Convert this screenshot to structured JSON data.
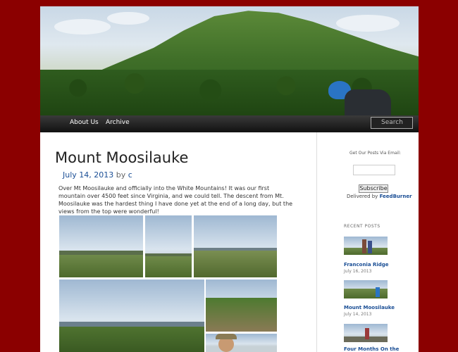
{
  "nav": {
    "items": [
      "About Us",
      "Archive"
    ],
    "search_placeholder": "Search"
  },
  "post": {
    "title": "Mount Moosilauke",
    "date": "July 14, 2013",
    "by": "by",
    "author": "c",
    "body": "Over Mt Moosilauke and officially into the White Mountains! It was our first mountain over 4500 feet since Virginia, and we could tell. The descent from Mt. Moosilauke was the hardest thing I have done yet at the end of a long day, but the views from the top were wonderful!"
  },
  "sidebar": {
    "email_label": "Get Our Posts Via Email:",
    "subscribe_label": "Subscribe",
    "delivered_by": "Delivered by",
    "feedburner": "FeedBurner",
    "recent_heading": "RECENT POSTS",
    "recent_posts": [
      {
        "title": "Franconia Ridge",
        "date": "July 16, 2013"
      },
      {
        "title": "Mount Moosilauke",
        "date": "July 14, 2013"
      },
      {
        "title": "Four Months On the",
        "date": ""
      }
    ]
  },
  "colors": {
    "background": "#8b0000",
    "link": "#1a4e95",
    "nav": "#1a1a1a"
  }
}
